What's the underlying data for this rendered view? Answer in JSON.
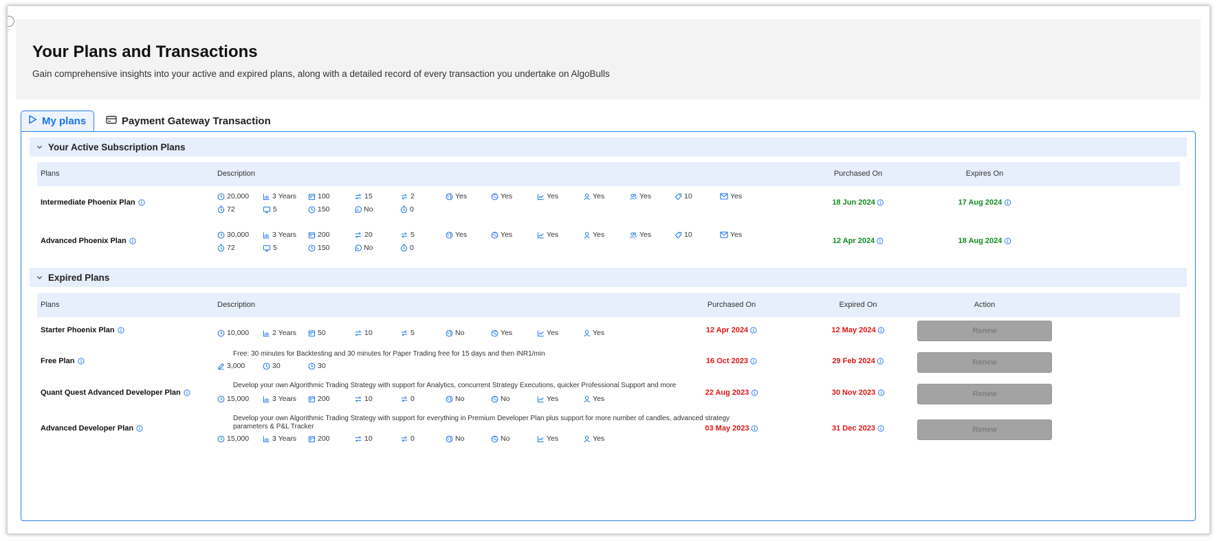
{
  "header": {
    "title": "Your Plans and Transactions",
    "subtitle": "Gain comprehensive insights into your active and expired plans, along with a detailed record of every transaction you undertake on AlgoBulls"
  },
  "tabs": [
    {
      "label": "My plans",
      "icon": "play-outline-icon",
      "active": true
    },
    {
      "label": "Payment Gateway Transaction",
      "icon": "card-icon",
      "active": false
    }
  ],
  "colors": {
    "accent": "#1a73e8",
    "active_date": "#11891f",
    "expired_date": "#e01414",
    "section_bg": "#e7eefc",
    "renew_bg": "#a3a3a3"
  },
  "active_section": {
    "title": "Your Active Subscription Plans",
    "columns": {
      "plans": "Plans",
      "description": "Description",
      "purchased": "Purchased On",
      "expires": "Expires On"
    },
    "rows": [
      {
        "name": "Intermediate Phoenix Plan",
        "purchased": "18 Jun 2024",
        "expires": "17 Aug 2024",
        "features_line1": [
          {
            "icon": "clock-icon",
            "text": "20,000"
          },
          {
            "icon": "bar-chart-icon",
            "text": "3 Years"
          },
          {
            "icon": "calendar-icon",
            "text": "100"
          },
          {
            "icon": "exchange-icon",
            "text": "15"
          },
          {
            "icon": "swap-icon",
            "text": "2"
          },
          {
            "icon": "globe-icon",
            "text": "Yes"
          },
          {
            "icon": "globe-alt-icon",
            "text": "Yes"
          },
          {
            "icon": "line-chart-icon",
            "text": "Yes"
          },
          {
            "icon": "user-icon",
            "text": "Yes"
          },
          {
            "icon": "users-icon",
            "text": "Yes"
          },
          {
            "icon": "tag-icon",
            "text": "10"
          },
          {
            "icon": "mail-icon",
            "text": "Yes"
          }
        ],
        "features_line2": [
          {
            "icon": "stopwatch-icon",
            "text": "72"
          },
          {
            "icon": "monitor-icon",
            "text": "5"
          },
          {
            "icon": "clock-icon",
            "text": "150"
          },
          {
            "icon": "whatsapp-icon",
            "text": "No"
          },
          {
            "icon": "stopwatch-icon",
            "text": "0"
          }
        ]
      },
      {
        "name": "Advanced Phoenix Plan",
        "purchased": "12 Apr 2024",
        "expires": "18 Aug 2024",
        "features_line1": [
          {
            "icon": "clock-icon",
            "text": "30,000"
          },
          {
            "icon": "bar-chart-icon",
            "text": "3 Years"
          },
          {
            "icon": "calendar-icon",
            "text": "200"
          },
          {
            "icon": "exchange-icon",
            "text": "20"
          },
          {
            "icon": "swap-icon",
            "text": "5"
          },
          {
            "icon": "globe-icon",
            "text": "Yes"
          },
          {
            "icon": "globe-alt-icon",
            "text": "Yes"
          },
          {
            "icon": "line-chart-icon",
            "text": "Yes"
          },
          {
            "icon": "user-icon",
            "text": "Yes"
          },
          {
            "icon": "users-icon",
            "text": "Yes"
          },
          {
            "icon": "tag-icon",
            "text": "10"
          },
          {
            "icon": "mail-icon",
            "text": "Yes"
          }
        ],
        "features_line2": [
          {
            "icon": "stopwatch-icon",
            "text": "72"
          },
          {
            "icon": "monitor-icon",
            "text": "5"
          },
          {
            "icon": "clock-icon",
            "text": "150"
          },
          {
            "icon": "whatsapp-icon",
            "text": "No"
          },
          {
            "icon": "stopwatch-icon",
            "text": "0"
          }
        ]
      }
    ]
  },
  "expired_section": {
    "title": "Expired Plans",
    "columns": {
      "plans": "Plans",
      "description": "Description",
      "purchased": "Purchased On",
      "expired": "Expired On",
      "action": "Action"
    },
    "renew_label": "Renew",
    "rows": [
      {
        "name": "Starter Phoenix Plan",
        "description": "",
        "description2": "",
        "purchased": "12 Apr 2024",
        "expired": "12 May 2024",
        "features": [
          {
            "icon": "clock-icon",
            "text": "10,000"
          },
          {
            "icon": "bar-chart-icon",
            "text": "2 Years"
          },
          {
            "icon": "calendar-icon",
            "text": "50"
          },
          {
            "icon": "exchange-icon",
            "text": "10"
          },
          {
            "icon": "swap-icon",
            "text": "5"
          },
          {
            "icon": "globe-icon",
            "text": "No"
          },
          {
            "icon": "globe-alt-icon",
            "text": "Yes"
          },
          {
            "icon": "line-chart-icon",
            "text": "Yes"
          },
          {
            "icon": "user-icon",
            "text": "Yes"
          }
        ]
      },
      {
        "name": "Free Plan",
        "description": "Free: 30 minutes for Backtesting and 30 minutes for Paper Trading free for 15 days and then INR1/min",
        "description2": "",
        "purchased": "16 Oct 2023",
        "expired": "29 Feb 2024",
        "features": [
          {
            "icon": "pencil-icon",
            "text": "3,000"
          },
          {
            "icon": "clock-icon",
            "text": "30"
          },
          {
            "icon": "clock-icon",
            "text": "30"
          }
        ]
      },
      {
        "name": "Quant Quest Advanced Developer Plan",
        "description": "Develop your own Algorithmic Trading Strategy with support for Analytics, concurrent Strategy Executions, quicker Professional Support and more",
        "description2": "",
        "purchased": "22 Aug 2023",
        "expired": "30 Nov 2023",
        "features": [
          {
            "icon": "clock-icon",
            "text": "15,000"
          },
          {
            "icon": "bar-chart-icon",
            "text": "3 Years"
          },
          {
            "icon": "calendar-icon",
            "text": "200"
          },
          {
            "icon": "exchange-icon",
            "text": "10"
          },
          {
            "icon": "swap-icon",
            "text": "0"
          },
          {
            "icon": "globe-icon",
            "text": "No"
          },
          {
            "icon": "globe-alt-icon",
            "text": "No"
          },
          {
            "icon": "line-chart-icon",
            "text": "Yes"
          },
          {
            "icon": "user-icon",
            "text": "Yes"
          }
        ]
      },
      {
        "name": "Advanced Developer Plan",
        "description": "Develop your own Algorithmic Trading Strategy with support for everything in Premium Developer Plan plus support for more number of candles, advanced strategy",
        "description2": "parameters & P&L Tracker",
        "purchased": "03 May 2023",
        "expired": "31 Dec 2023",
        "features": [
          {
            "icon": "clock-icon",
            "text": "15,000"
          },
          {
            "icon": "bar-chart-icon",
            "text": "3 Years"
          },
          {
            "icon": "calendar-icon",
            "text": "200"
          },
          {
            "icon": "exchange-icon",
            "text": "10"
          },
          {
            "icon": "swap-icon",
            "text": "0"
          },
          {
            "icon": "globe-icon",
            "text": "No"
          },
          {
            "icon": "globe-alt-icon",
            "text": "No"
          },
          {
            "icon": "line-chart-icon",
            "text": "Yes"
          },
          {
            "icon": "user-icon",
            "text": "Yes"
          }
        ]
      }
    ]
  }
}
